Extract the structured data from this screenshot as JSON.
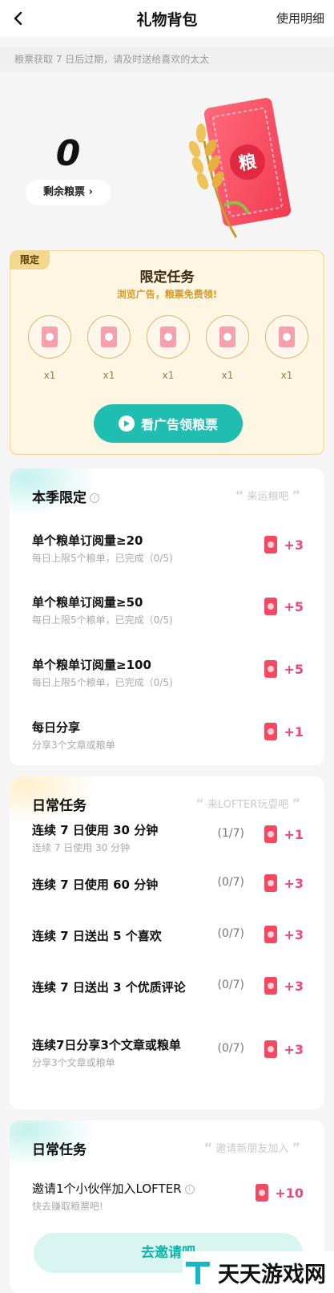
{
  "header": {
    "title": "礼物背包",
    "detail_link": "使用明细"
  },
  "notice": "粮票获取 7 日后过期，请及时送给喜欢的太太",
  "balance": {
    "value": "0",
    "label": "剩余粮票 ›"
  },
  "hero_ticket_char": "粮",
  "limited": {
    "tag": "限定",
    "title": "限定任务",
    "subtitle": "浏览广告，粮票免费领!",
    "tickets": [
      {
        "count": "x1"
      },
      {
        "count": "x1"
      },
      {
        "count": "x1"
      },
      {
        "count": "x1"
      },
      {
        "count": "x1"
      }
    ],
    "button_label": "看广告领粮票"
  },
  "season": {
    "title": "本季限定",
    "slogan": "来运粮吧",
    "tasks": [
      {
        "title": "单个粮单订阅量≥20",
        "desc": "每日上限5个粮单，已完成（0/5)",
        "reward": "+3"
      },
      {
        "title": "单个粮单订阅量≥50",
        "desc": "每日上限5个粮单，已完成（0/5)",
        "reward": "+5"
      },
      {
        "title": "单个粮单订阅量≥100",
        "desc": "每日上限5个粮单，已完成（0/5)",
        "reward": "+5"
      },
      {
        "title": "每日分享",
        "desc": "分享3个文章或粮单",
        "reward": "+1"
      }
    ]
  },
  "daily": {
    "title": "日常任务",
    "slogan": "来LOFTER玩耍吧",
    "tasks": [
      {
        "title": "连续 7 日使用 30 分钟",
        "desc": "连续 7 日使用 30 分钟",
        "progress": "(1/7)",
        "reward": "+1"
      },
      {
        "title": "连续 7 日使用 60 分钟",
        "desc": "",
        "progress": "(0/7)",
        "reward": "+3"
      },
      {
        "title": "连续 7 日送出 5 个喜欢",
        "desc": "",
        "progress": "(0/7)",
        "reward": "+3"
      },
      {
        "title": "连续 7 日送出 3 个优质评论",
        "desc": "",
        "progress": "(0/7)",
        "reward": "+3"
      },
      {
        "title": "连续7日分享3个文章或粮单",
        "desc": "分享3个文章或粮单",
        "progress": "(0/7)",
        "reward": "+3"
      }
    ]
  },
  "invite": {
    "title": "日常任务",
    "slogan": "邀请新朋友加入",
    "task_title": "邀请1个小伙伴加入LOFTER",
    "task_desc": "快去赚取粮票吧!",
    "reward": "+10",
    "button_label": "去邀请吧"
  },
  "watermark": "天天游戏网",
  "colors": {
    "accent_teal": "#1fbeb0",
    "reward_pink": "#f0457d",
    "limited_bg": "#fdf6e3"
  }
}
